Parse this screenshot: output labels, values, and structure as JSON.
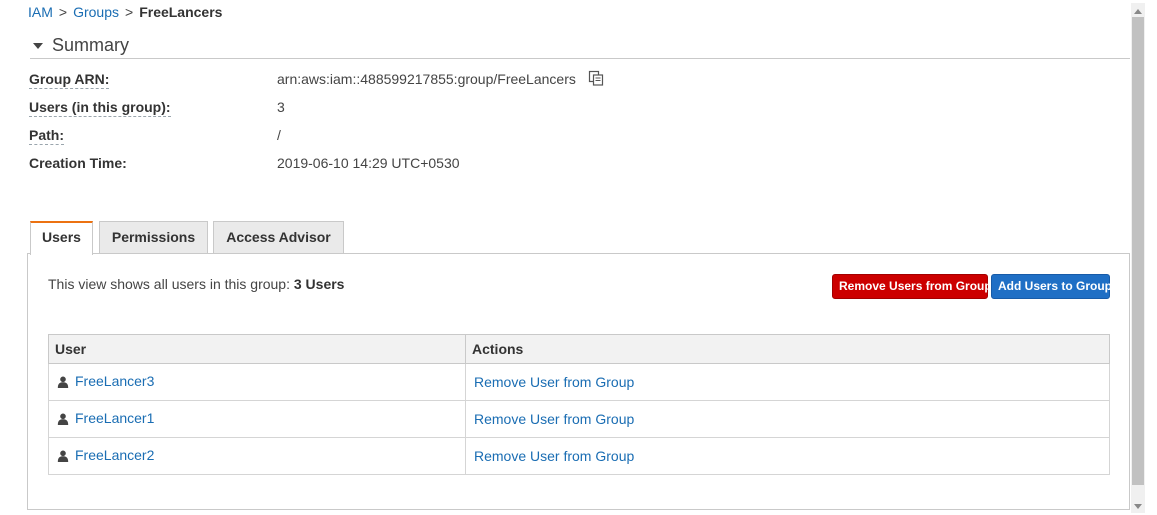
{
  "breadcrumb": {
    "items": [
      "IAM",
      "Groups"
    ],
    "separator": ">",
    "current": "FreeLancers"
  },
  "summary": {
    "title": "Summary",
    "fields": {
      "arn_label": "Group ARN:",
      "arn_value": "arn:aws:iam::488599217855:group/FreeLancers",
      "users_label": "Users (in this group):",
      "users_value": "3",
      "path_label": "Path:",
      "path_value": "/",
      "created_label": "Creation Time:",
      "created_value": "2019-06-10 14:29 UTC+0530"
    }
  },
  "tabs": {
    "users": "Users",
    "permissions": "Permissions",
    "access_advisor": "Access Advisor",
    "active": "Users"
  },
  "users_panel": {
    "description": "This view shows all users in this group: ",
    "count_text": "3 Users",
    "remove_button": "Remove Users from Group",
    "add_button": "Add Users to Group",
    "columns": [
      "User",
      "Actions"
    ],
    "rows": [
      {
        "user": "FreeLancer3",
        "action": "Remove User from Group"
      },
      {
        "user": "FreeLancer1",
        "action": "Remove User from Group"
      },
      {
        "user": "FreeLancer2",
        "action": "Remove User from Group"
      }
    ]
  },
  "colors": {
    "link": "#1a6db3",
    "danger": "#cc0000",
    "primary": "#1f6fc5",
    "tab_accent": "#ec7211"
  },
  "icons": {
    "copy": "copy-icon",
    "user": "user-icon",
    "collapse": "caret-down-icon"
  }
}
